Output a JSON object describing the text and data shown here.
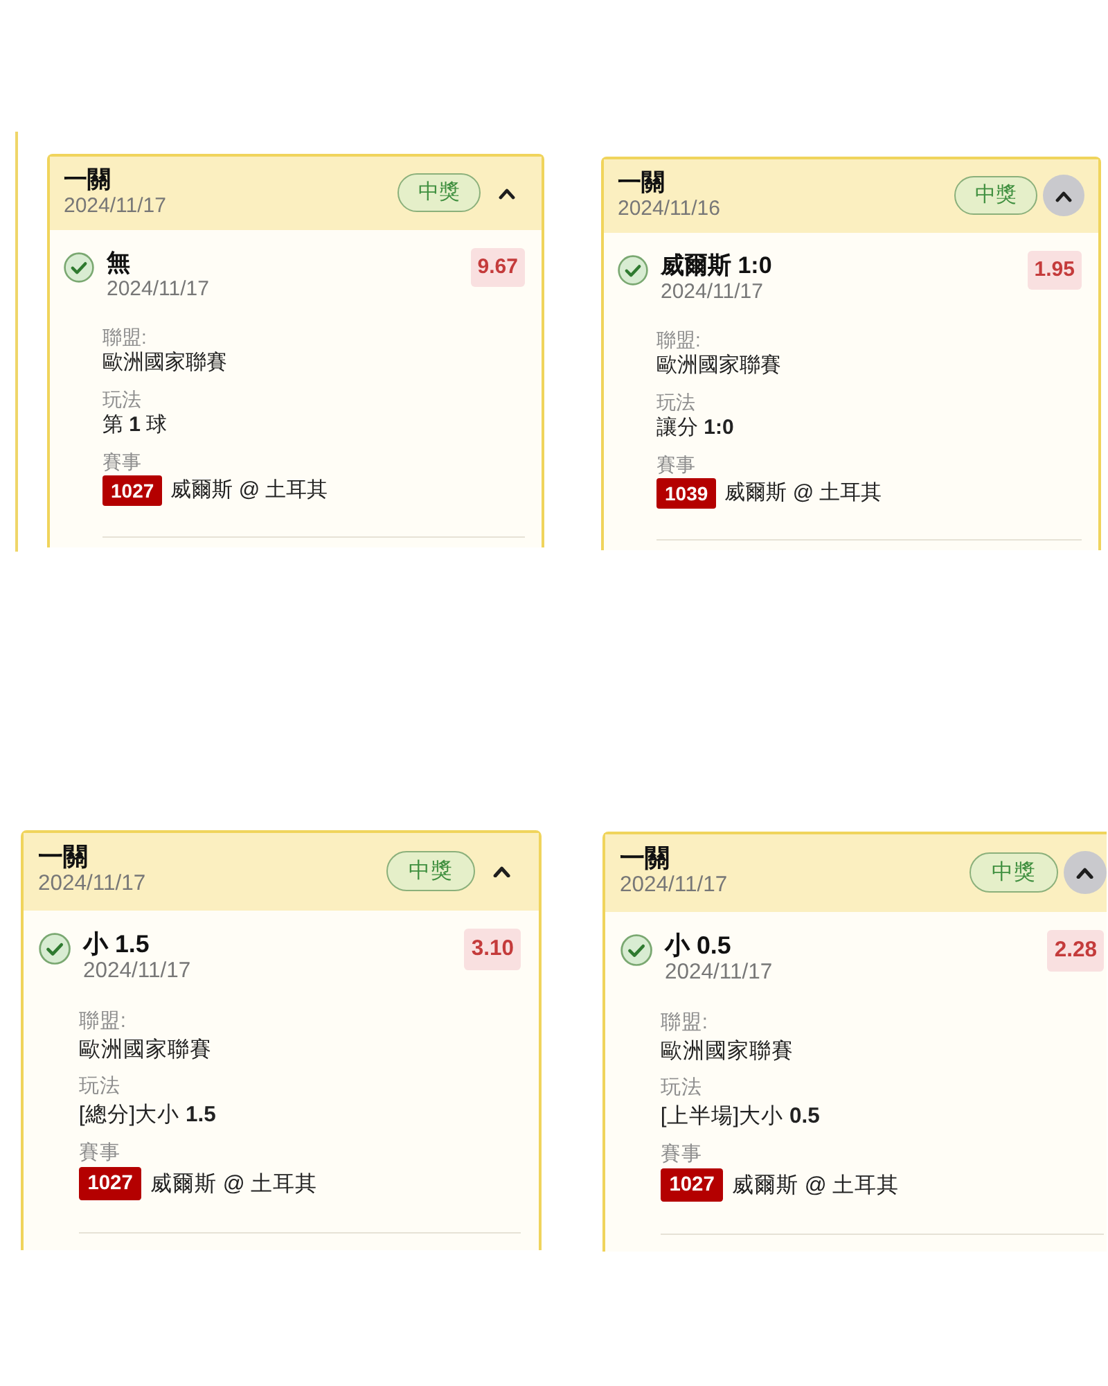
{
  "cards": [
    {
      "title": "一關",
      "date": "2024/11/17",
      "status": "中獎",
      "expanded": true,
      "toggle_highlighted": false,
      "legs": [
        {
          "won": true,
          "selection": "無",
          "date": "2024/11/17",
          "odds": "9.67",
          "league_label": "聯盟:",
          "league": "歐洲國家聯賽",
          "bet_type_label": "玩法",
          "bet_type": "第 **1** 球",
          "match_label": "賽事",
          "match_no": "1027",
          "match": "威爾斯 @ 土耳其"
        }
      ]
    },
    {
      "title": "一關",
      "date": "2024/11/16",
      "status": "中獎",
      "expanded": true,
      "toggle_highlighted": true,
      "legs": [
        {
          "won": true,
          "selection": "威爾斯 1:0",
          "date": "2024/11/17",
          "odds": "1.95",
          "league_label": "聯盟:",
          "league": "歐洲國家聯賽",
          "bet_type_label": "玩法",
          "bet_type": "讓分 **1:0**",
          "match_label": "賽事",
          "match_no": "1039",
          "match": "威爾斯 @ 土耳其"
        }
      ]
    },
    {
      "title": "一關",
      "date": "2024/11/17",
      "status": "中獎",
      "expanded": true,
      "toggle_highlighted": false,
      "legs": [
        {
          "won": true,
          "selection": "小 1.5",
          "date": "2024/11/17",
          "odds": "3.10",
          "league_label": "聯盟:",
          "league": "歐洲國家聯賽",
          "bet_type_label": "玩法",
          "bet_type": "[總分]大小 **1.5**",
          "match_label": "賽事",
          "match_no": "1027",
          "match": "威爾斯 @ 土耳其"
        }
      ]
    },
    {
      "title": "一關",
      "date": "2024/11/17",
      "status": "中獎",
      "expanded": true,
      "toggle_highlighted": true,
      "legs": [
        {
          "won": true,
          "selection": "小 0.5",
          "date": "2024/11/17",
          "odds": "2.28",
          "league_label": "聯盟:",
          "league": "歐洲國家聯賽",
          "bet_type_label": "玩法",
          "bet_type": "[上半場]大小 **0.5**",
          "match_label": "賽事",
          "match_no": "1027",
          "match": "威爾斯 @ 土耳其"
        }
      ]
    }
  ]
}
